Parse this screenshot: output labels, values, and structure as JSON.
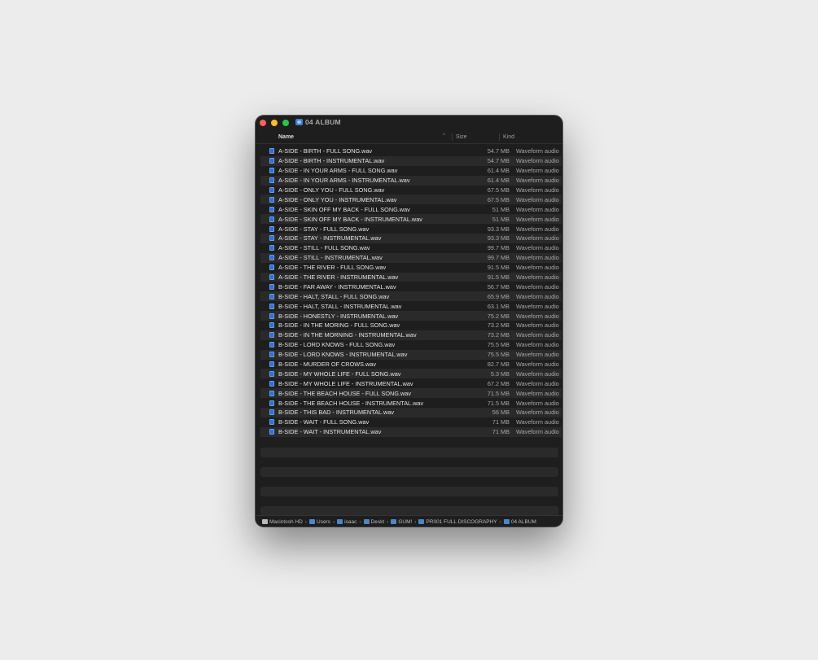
{
  "window": {
    "title": "04 ALBUM"
  },
  "columns": {
    "name": "Name",
    "size": "Size",
    "kind": "Kind"
  },
  "files": [
    {
      "name": "A-SIDE - BIRTH - FULL SONG.wav",
      "size": "54.7 MB",
      "kind": "Waveform audio"
    },
    {
      "name": "A-SIDE - BIRTH - INSTRUMENTAL.wav",
      "size": "54.7 MB",
      "kind": "Waveform audio"
    },
    {
      "name": "A-SIDE - IN YOUR ARMS - FULL SONG.wav",
      "size": "61.4 MB",
      "kind": "Waveform audio"
    },
    {
      "name": "A-SIDE - IN YOUR ARMS - INSTRUMENTAL.wav",
      "size": "61.4 MB",
      "kind": "Waveform audio"
    },
    {
      "name": "A-SIDE - ONLY YOU - FULL SONG.wav",
      "size": "67.5 MB",
      "kind": "Waveform audio"
    },
    {
      "name": "A-SIDE - ONLY YOU - INSTRUMENTAL.wav",
      "size": "67.5 MB",
      "kind": "Waveform audio"
    },
    {
      "name": "A-SIDE - SKIN OFF MY BACK - FULL SONG.wav",
      "size": "51 MB",
      "kind": "Waveform audio"
    },
    {
      "name": "A-SIDE - SKIN OFF MY BACK - INSTRUMENTAL.wav",
      "size": "51 MB",
      "kind": "Waveform audio"
    },
    {
      "name": "A-SIDE - STAY - FULL SONG.wav",
      "size": "93.3 MB",
      "kind": "Waveform audio"
    },
    {
      "name": "A-SIDE - STAY - INSTRUMENTAL.wav",
      "size": "93.3 MB",
      "kind": "Waveform audio"
    },
    {
      "name": "A-SIDE - STILL - FULL SONG.wav",
      "size": "99.7 MB",
      "kind": "Waveform audio"
    },
    {
      "name": "A-SIDE - STILL - INSTRUMENTAL.wav",
      "size": "99.7 MB",
      "kind": "Waveform audio"
    },
    {
      "name": "A-SIDE - THE RIVER - FULL SONG.wav",
      "size": "91.5 MB",
      "kind": "Waveform audio"
    },
    {
      "name": "A-SIDE - THE RIVER - INSTRUMENTAL.wav",
      "size": "91.5 MB",
      "kind": "Waveform audio"
    },
    {
      "name": "B-SIDE - FAR AWAY - INSTRUMENTAL.wav",
      "size": "56.7 MB",
      "kind": "Waveform audio"
    },
    {
      "name": "B-SIDE - HALT, STALL - FULL SONG.wav",
      "size": "65.9 MB",
      "kind": "Waveform audio"
    },
    {
      "name": "B-SIDE - HALT, STALL - INSTRUMENTAL.wav",
      "size": "63.1 MB",
      "kind": "Waveform audio"
    },
    {
      "name": "B-SIDE - HONESTLY - INSTRUMENTAL.wav",
      "size": "75.2 MB",
      "kind": "Waveform audio"
    },
    {
      "name": "B-SIDE - IN THE MORING - FULL SONG.wav",
      "size": "73.2 MB",
      "kind": "Waveform audio"
    },
    {
      "name": "B-SIDE - IN THE MORNING - INSTRUMENTAL.wav",
      "size": "73.2 MB",
      "kind": "Waveform audio"
    },
    {
      "name": "B-SIDE - LORD KNOWS - FULL SONG.wav",
      "size": "75.5 MB",
      "kind": "Waveform audio"
    },
    {
      "name": "B-SIDE - LORD KNOWS - INSTRUMENTAL.wav",
      "size": "75.5 MB",
      "kind": "Waveform audio"
    },
    {
      "name": "B-SIDE - MURDER OF CROWS.wav",
      "size": "82.7 MB",
      "kind": "Waveform audio"
    },
    {
      "name": "B-SIDE - MY WHOLE LIFE - FULL SONG.wav",
      "size": "5.3 MB",
      "kind": "Waveform audio"
    },
    {
      "name": "B-SIDE - MY WHOLE LIFE - INSTRUMENTAL.wav",
      "size": "67.2 MB",
      "kind": "Waveform audio"
    },
    {
      "name": "B-SIDE - THE BEACH HOUSE - FULL SONG.wav",
      "size": "71.5 MB",
      "kind": "Waveform audio"
    },
    {
      "name": "B-SIDE - THE BEACH HOUSE - INSTRUMENTAL.wav",
      "size": "71.5 MB",
      "kind": "Waveform audio"
    },
    {
      "name": "B-SIDE - THIS BAD - INSTRUMENTAL.wav",
      "size": "56 MB",
      "kind": "Waveform audio"
    },
    {
      "name": "B-SIDE - WAIT - FULL SONG.wav",
      "size": "71 MB",
      "kind": "Waveform audio"
    },
    {
      "name": "B-SIDE - WAIT - INSTRUMENTAL.wav",
      "size": "71 MB",
      "kind": "Waveform audio"
    }
  ],
  "pathbar": [
    {
      "label": "Macintosh HD",
      "icon": "drive-icon"
    },
    {
      "label": "Users",
      "icon": "folder-icon"
    },
    {
      "label": "isaac",
      "icon": "home-folder-icon"
    },
    {
      "label": "Deskt",
      "icon": "folder-icon"
    },
    {
      "label": "GUM!",
      "icon": "folder-icon"
    },
    {
      "label": "PR001 FULL DISCOGRAPHY",
      "icon": "folder-icon"
    },
    {
      "label": "04 ALBUM",
      "icon": "album-folder-icon"
    }
  ],
  "colors": {
    "window_bg": "#1e1e1e",
    "stripe": "#2a2a2a",
    "close": "#ff5f57",
    "minimize": "#febc2e",
    "zoom": "#28c840",
    "file_icon": "#2f6fcf"
  }
}
